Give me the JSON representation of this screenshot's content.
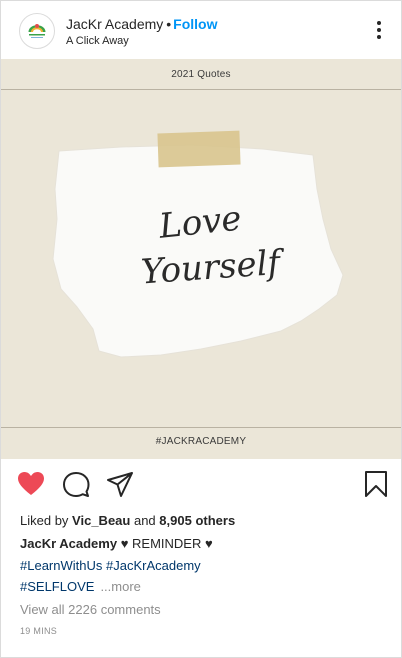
{
  "header": {
    "username": "JacKr Academy",
    "separator": "•",
    "follow_label": "Follow",
    "subtitle": "A Click Away",
    "avatar_icon": "jackr-academy-logo",
    "more_icon": "more-vertical-icon"
  },
  "image": {
    "top_title": "2021 Quotes",
    "note_line1": "Love",
    "note_line2": "Yourself",
    "bottom_tag": "#JACKRACADEMY",
    "background_color": "#ebe6d8",
    "tape_color": "#d9c68f"
  },
  "actions": {
    "like_icon": "heart-filled-icon",
    "like_color": "#ed4956",
    "comment_icon": "comment-icon",
    "share_icon": "send-icon",
    "save_icon": "bookmark-icon"
  },
  "details": {
    "liked_by_prefix": "Liked by",
    "liked_by_user": "Vic_Beau",
    "liked_by_and": "and",
    "liked_by_count": "8,905 others",
    "caption_user": "JacKr Academy",
    "caption_text": "♥ REMINDER ♥",
    "hashtag_1": "#LearnWithUs",
    "hashtag_2": "#JacKrAcademy",
    "hashtag_3": "#SELFLOVE",
    "more_label": "...more",
    "view_comments": "View all 2226 comments",
    "time": "19 MINS"
  }
}
